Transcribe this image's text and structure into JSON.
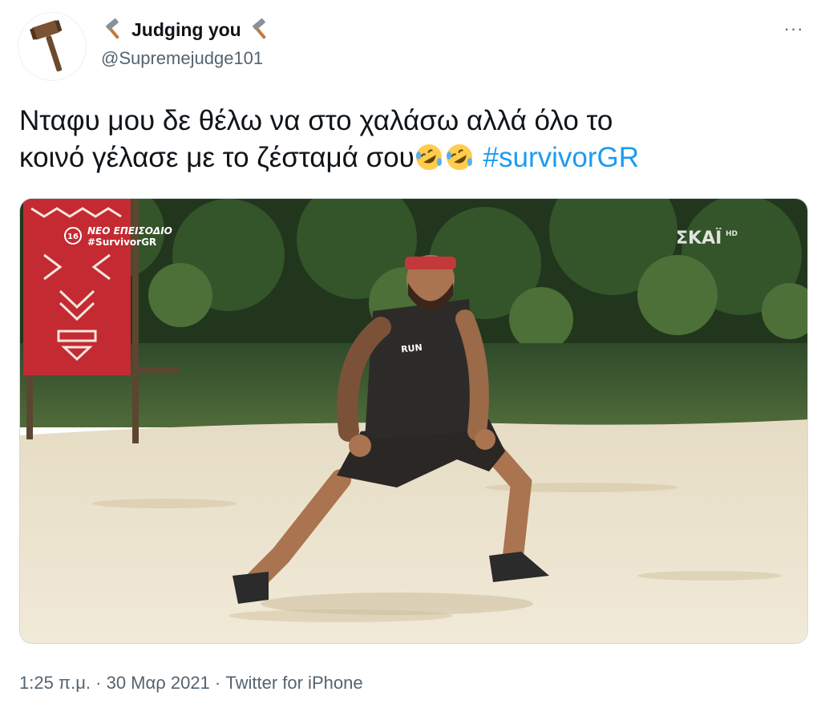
{
  "author": {
    "display_name": "Judging you",
    "handle": "@Supremejudge101",
    "avatar_icon": "gavel-icon",
    "name_icons": [
      "hammer-icon",
      "hammer-icon"
    ]
  },
  "menu": {
    "more_label": "···"
  },
  "tweet": {
    "text_line1": "Νταφυ μου δε θέλω να στο χαλάσω αλλά όλο το",
    "text_line2": "κοινό γέλασε με το ζέσταμά σου",
    "emojis": [
      "rofl-emoji",
      "rofl-emoji"
    ],
    "hashtag": "#survivorGR"
  },
  "media": {
    "overlay_episode": "ΝΕΟ ΕΠΕΙΣΟΔΙΟ",
    "overlay_hashtag": "#SurvivorGR",
    "overlay_badge": "16",
    "channel_logo": "ΣΚΑΪ",
    "channel_hd": "HD",
    "shirt_text": "RUN"
  },
  "meta": {
    "time": "1:25 π.μ.",
    "separator1": "·",
    "date": "30 Μαρ 2021",
    "separator2": "·",
    "source": "Twitter for iPhone"
  },
  "colors": {
    "hashtag": "#1d9bf0",
    "secondary_text": "#536471",
    "flag_red": "#c42a32"
  }
}
